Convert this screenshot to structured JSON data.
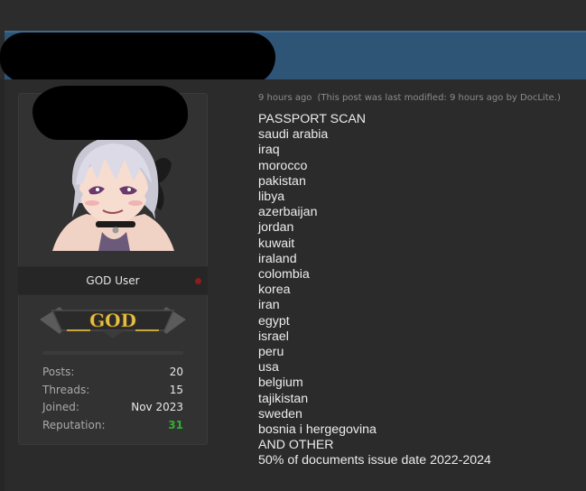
{
  "post": {
    "time": "9 hours ago",
    "modified_note": "(This post was last modified: 9 hours ago by DocLite.)",
    "lines": [
      "PASSPORT SCAN",
      "saudi arabia",
      "iraq",
      "morocco",
      "pakistan",
      "libya",
      "azerbaijan",
      "jordan",
      "kuwait",
      "iraland",
      "colombia",
      "korea",
      "iran",
      "egypt",
      "israel",
      "peru",
      "usa",
      "belgium",
      "tajikistan",
      "sweden",
      "bosnia i hergegovina",
      "AND OTHER",
      "50% of documents issue date 2022-2024"
    ]
  },
  "user": {
    "title": "GOD User",
    "rank_text": "GOD",
    "status_color": "#8e1c1c",
    "stats": {
      "posts_label": "Posts:",
      "posts_value": "20",
      "threads_label": "Threads:",
      "threads_value": "15",
      "joined_label": "Joined:",
      "joined_value": "Nov 2023",
      "reputation_label": "Reputation:",
      "reputation_value": "31"
    }
  },
  "colors": {
    "header_bar": "#2e5476",
    "reputation_positive": "#2fb12f",
    "rank_gold": "#e6c04a"
  }
}
